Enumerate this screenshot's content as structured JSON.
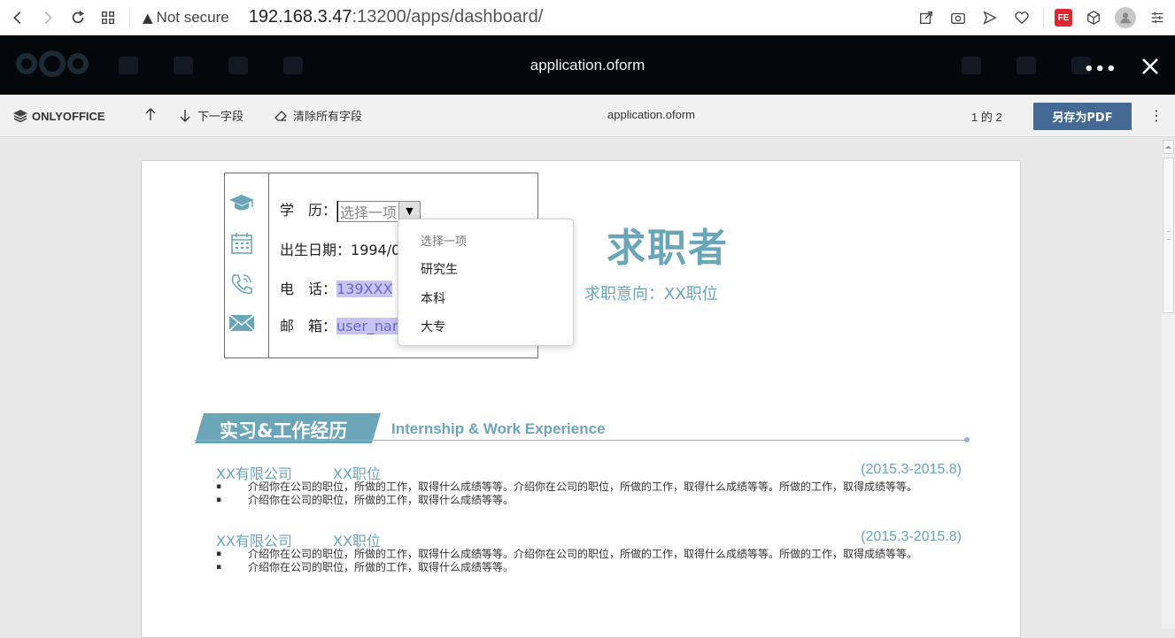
{
  "browser": {
    "security": "Not secure",
    "url_host": "192.168.3.47",
    "url_rest": ":13200/apps/dashboard/",
    "ext_badge": "FE"
  },
  "nextcloud": {
    "title": "application.oform",
    "more": "•••"
  },
  "toolbar": {
    "logo": "ONLYOFFICE",
    "next_field": "下一字段",
    "clear_fields": "清除所有字段",
    "doc_title": "application.oform",
    "page_indicator": "1 的 2",
    "save_pdf": "另存为PDF"
  },
  "resume": {
    "education_label": "学　历：",
    "education_placeholder": "选择一项",
    "birth_label": "出生日期：",
    "birth_value": "1994/0",
    "phone_label": "电　话：",
    "phone_value": "139XXX",
    "email_label": "邮　箱：",
    "email_value": "user_nar",
    "title": "求职者",
    "subtitle": "求职意向：XX职位",
    "section_cn": "实习&工作经历",
    "section_en": "Internship & Work Experience",
    "jobs": [
      {
        "company": "XX有限公司",
        "position": "XX职位",
        "date": "(2015.3-2015.8)",
        "bullets": [
          "介绍你在公司的职位，所做的工作，取得什么成绩等等。介绍你在公司的职位，所做的工作，取得什么成绩等等。所做的工作，取得成绩等等。",
          "介绍你在公司的职位，所做的工作，取得什么成绩等等。"
        ]
      },
      {
        "company": "XX有限公司",
        "position": "XX职位",
        "date": "(2015.3-2015.8)",
        "bullets": [
          "介绍你在公司的职位，所做的工作，取得什么成绩等等。介绍你在公司的职位，所做的工作，取得什么成绩等等。所做的工作，取得成绩等等。",
          "介绍你在公司的职位，所做的工作，取得什么成绩等等。"
        ]
      }
    ]
  },
  "dropdown": {
    "options": [
      "选择一项",
      "研究生",
      "本科",
      "大专"
    ]
  },
  "colors": {
    "accent": "#6aa6b8",
    "save_button": "#446995",
    "header_bg": "#04070b",
    "field_highlight": "#c7c4f4"
  },
  "icons": {
    "back": "back-arrow-icon",
    "forward": "forward-arrow-icon",
    "reload": "reload-icon",
    "apps": "apps-grid-icon",
    "warning": "warning-icon",
    "close": "close-icon"
  }
}
